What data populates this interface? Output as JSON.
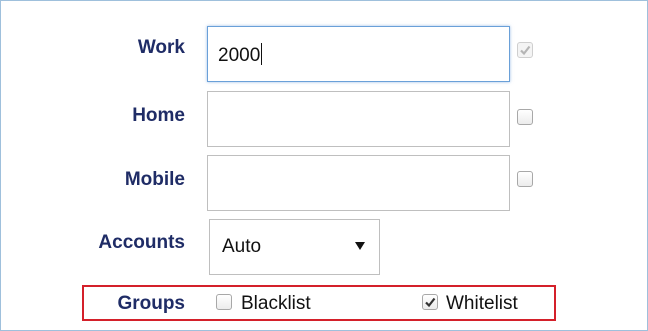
{
  "form": {
    "work": {
      "label": "Work",
      "value": "2000",
      "checkbox_checked": true,
      "checkbox_disabled": true
    },
    "home": {
      "label": "Home",
      "value": "",
      "checkbox_checked": false
    },
    "mobile": {
      "label": "Mobile",
      "value": "",
      "checkbox_checked": false
    },
    "accounts": {
      "label": "Accounts",
      "selected": "Auto"
    },
    "groups": {
      "label": "Groups",
      "options": [
        {
          "label": "Blacklist",
          "checked": false
        },
        {
          "label": "Whitelist",
          "checked": true
        }
      ]
    }
  },
  "colors": {
    "label_text": "#1f2c66",
    "focus_border": "#6aa0d8",
    "highlight_box": "#d4202a",
    "frame_border": "#9fc0dc"
  }
}
